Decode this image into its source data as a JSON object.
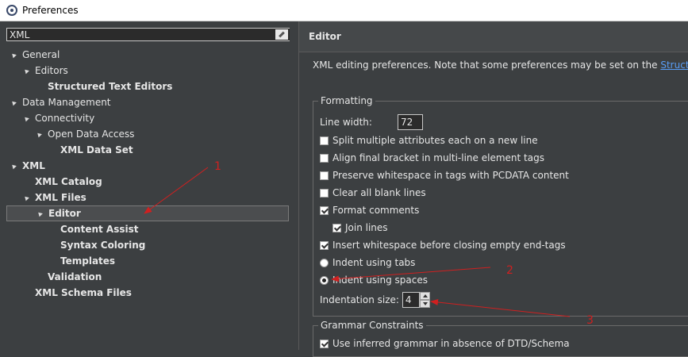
{
  "window": {
    "title": "Preferences"
  },
  "filter": {
    "value": "XML"
  },
  "tree": [
    {
      "label": "General",
      "bold": false,
      "expanded": true,
      "depth": 0
    },
    {
      "label": "Editors",
      "bold": false,
      "expanded": true,
      "depth": 1
    },
    {
      "label": "Structured Text Editors",
      "bold": true,
      "expanded": false,
      "depth": 2
    },
    {
      "label": "Data Management",
      "bold": false,
      "expanded": true,
      "depth": 0
    },
    {
      "label": "Connectivity",
      "bold": false,
      "expanded": true,
      "depth": 1
    },
    {
      "label": "Open Data Access",
      "bold": false,
      "expanded": true,
      "depth": 2
    },
    {
      "label": "XML Data Set",
      "bold": true,
      "expanded": false,
      "depth": 3
    },
    {
      "label": "XML",
      "bold": true,
      "expanded": true,
      "depth": 0
    },
    {
      "label": "XML Catalog",
      "bold": true,
      "expanded": false,
      "depth": 1
    },
    {
      "label": "XML Files",
      "bold": true,
      "expanded": true,
      "depth": 1
    },
    {
      "label": "Editor",
      "bold": true,
      "expanded": true,
      "depth": 2,
      "selected": true
    },
    {
      "label": "Content Assist",
      "bold": true,
      "expanded": false,
      "depth": 3
    },
    {
      "label": "Syntax Coloring",
      "bold": true,
      "expanded": false,
      "depth": 3
    },
    {
      "label": "Templates",
      "bold": true,
      "expanded": false,
      "depth": 3
    },
    {
      "label": "Validation",
      "bold": true,
      "expanded": false,
      "depth": 2
    },
    {
      "label": "XML Schema Files",
      "bold": true,
      "expanded": false,
      "depth": 1
    }
  ],
  "editor": {
    "header": "Editor",
    "description": "XML editing preferences.  Note that some preferences may be set on the ",
    "description_link": "Structu",
    "formatting": {
      "legend": "Formatting",
      "line_width_label": "Line width:",
      "line_width_value": "72",
      "checkboxes": [
        {
          "label": "Split multiple attributes each on a new line",
          "checked": false
        },
        {
          "label": "Align final bracket in multi-line element tags",
          "checked": false
        },
        {
          "label": "Preserve whitespace in tags with PCDATA content",
          "checked": false
        },
        {
          "label": "Clear all blank lines",
          "checked": false
        },
        {
          "label": "Format comments",
          "checked": true
        },
        {
          "label": "Join lines",
          "checked": true
        },
        {
          "label": "Insert whitespace before closing empty end-tags",
          "checked": true
        }
      ],
      "radios": [
        {
          "label": "Indent using tabs",
          "checked": false
        },
        {
          "label": "Indent using spaces",
          "checked": true
        }
      ],
      "indentation_label": "Indentation size:",
      "indentation_value": "4"
    },
    "grammar": {
      "legend": "Grammar Constraints",
      "checkbox_label": "Use inferred grammar in absence of DTD/Schema",
      "checkbox_checked": true
    }
  },
  "annotations": [
    "1",
    "2",
    "3"
  ],
  "colors": {
    "annotation": "#d02020",
    "link": "#589df6",
    "background": "#3c3f41"
  }
}
